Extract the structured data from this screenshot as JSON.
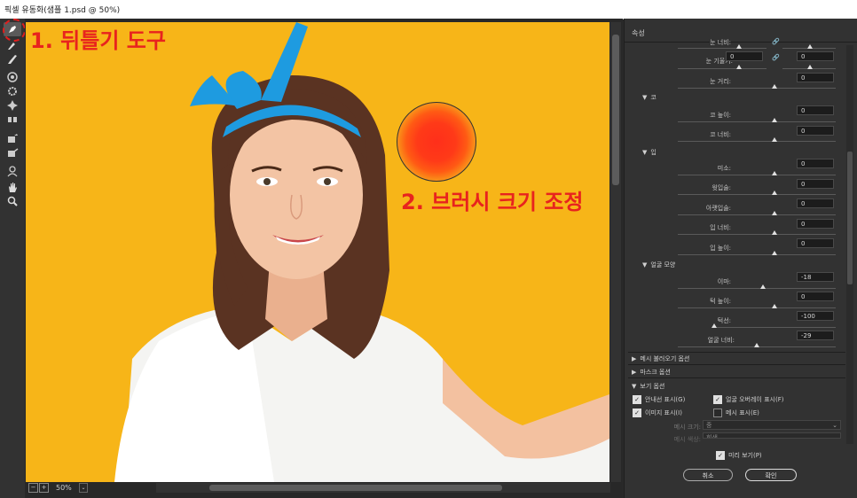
{
  "window": {
    "title": "픽셀 유동화(샘플 1.psd @ 50%)"
  },
  "annotations": {
    "step1": "1. 뒤틀기 도구",
    "step2": "2. 브러시 크기 조정"
  },
  "status": {
    "zoom": "50%",
    "dropdown": "⌄"
  },
  "panel": {
    "title": "속성",
    "top_row": {
      "label": "눈 너비:"
    },
    "eye_tilt": {
      "label": "눈 기울기:",
      "left": "0",
      "right": "0"
    },
    "eye_distance": {
      "label": "눈 거리:",
      "value": "0"
    },
    "nose": {
      "title": "코",
      "height_label": "코 높이:",
      "height": "0",
      "width_label": "코 너비:",
      "width": "0"
    },
    "mouth": {
      "title": "입",
      "smile_label": "미소:",
      "smile": "0",
      "upper_lip_label": "윗입술:",
      "upper_lip": "0",
      "lower_lip_label": "아랫입술:",
      "lower_lip": "0",
      "width_label": "입 너비:",
      "width": "0",
      "height_label": "입 높이:",
      "height": "0"
    },
    "face_shape": {
      "title": "얼굴 모양",
      "forehead_label": "이마:",
      "forehead": "-18",
      "chin_height_label": "턱 높이:",
      "chin_height": "0",
      "jawline_label": "턱선:",
      "jawline": "-100",
      "face_width_label": "얼굴 너비:",
      "face_width": "-29"
    },
    "load_mesh": "메시 불러오기 옵션",
    "mask_options": "마스크 옵션",
    "view_options": {
      "title": "보기 옵션",
      "show_guides": "안내선 표시(G)",
      "show_face_overlay": "얼굴 오버레이 표시(F)",
      "show_image": "이미지 표시(I)",
      "show_mesh": "메시 표시(E)",
      "mesh_size_label": "메시 크기:",
      "mesh_size": "중",
      "mesh_color_label": "메시 색상:",
      "mesh_color": "회색"
    },
    "preview": "미리 보기(P)",
    "cancel": "취소",
    "ok": "확인"
  }
}
